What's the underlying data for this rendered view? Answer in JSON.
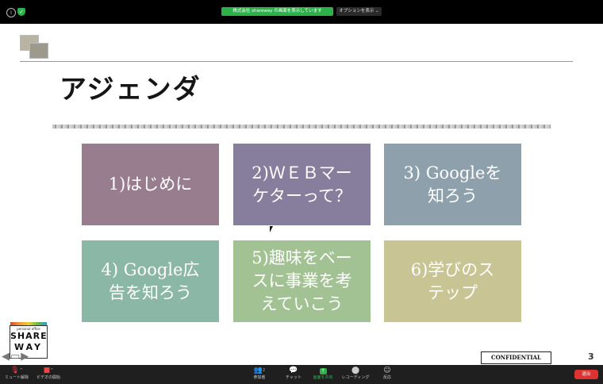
{
  "zoom_top": {
    "share_banner": "株式会社 shareway の画面を表示しています",
    "options_button": "オプションを表示 ⌄"
  },
  "slide": {
    "title": "アジェンダ",
    "cards": [
      {
        "label": "1)はじめに",
        "color": "#987d8e"
      },
      {
        "label": "2)ＷＥＢマー\nケターって？",
        "color": "#867e9c"
      },
      {
        "label": "3) Googleを\n知ろう",
        "color": "#8da0ac"
      },
      {
        "label": "4) Google広\n告を知ろう",
        "color": "#8bb7a7"
      },
      {
        "label": "5)趣味をベー\nスに事業を考\nえていこう",
        "color": "#a2c294"
      },
      {
        "label": "6)学びのス\nテップ",
        "color": "#c8c494"
      }
    ],
    "logo": {
      "small_text": "personal office",
      "line1": "SHARE",
      "line2": "WAY"
    },
    "confidential": "CONFIDENTIAL",
    "page_number": "3"
  },
  "zoom_bottom": {
    "mute_label": "ミュート解除",
    "video_label": "ビデオの開始",
    "participants_label": "参加者",
    "participants_count": "2",
    "chat_label": "チャット",
    "share_label": "画面を共有",
    "record_label": "レコーディング",
    "reaction_label": "反応",
    "leave_label": "退出"
  }
}
